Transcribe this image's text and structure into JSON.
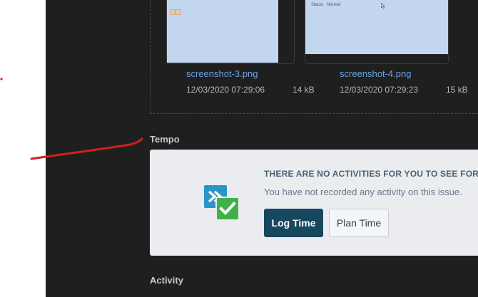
{
  "attachments": [
    {
      "name": "screenshot-3.png",
      "date": "12/03/2020 07:29:06",
      "size": "14 kB"
    },
    {
      "name": "screenshot-4.png",
      "date": "12/03/2020 07:29:23",
      "size": "15 kB"
    }
  ],
  "thumb_text": {
    "status": "Status",
    "normal": "Normal"
  },
  "sections": {
    "tempo_title": "Tempo",
    "activity_title": "Activity"
  },
  "tempo": {
    "heading": "THERE ARE NO ACTIVITIES FOR YOU TO SEE FOR",
    "message": "You have not recorded any activity on this issue.",
    "log_time_label": "Log Time",
    "plan_time_label": "Plan Time"
  },
  "colors": {
    "panel_background": "#1f1f1f",
    "link": "#6aa3e0",
    "primary_button": "#17475f",
    "annotation": "#d32020"
  },
  "icons": [
    "tempo-logo-icon",
    "checkmark-icon",
    "chevron-right-icon"
  ]
}
